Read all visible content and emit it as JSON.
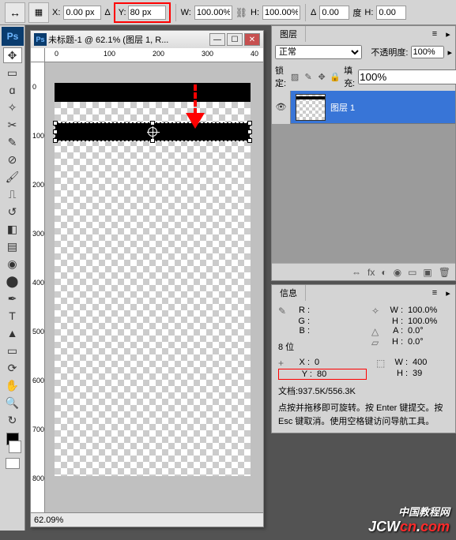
{
  "options": {
    "x_label": "X:",
    "x_value": "0.00 px",
    "delta_label": "Δ",
    "y_label": "Y:",
    "y_value": "80 px",
    "w_label": "W:",
    "w_value": "100.00%",
    "link_icon": "⛓",
    "h_label": "H:",
    "h_value": "100.00%",
    "angle_label": "Δ",
    "angle_value": "0.00",
    "angle_unit": "度",
    "skew_h_label": "H:",
    "skew_h_value": "0.00"
  },
  "doc": {
    "title": "未标题-1 @ 62.1% (图层 1, R...",
    "zoom": "62.09%",
    "ruler_marks_h": [
      "0",
      "100",
      "200",
      "300",
      "40"
    ],
    "ruler_marks_v": [
      "0",
      "100",
      "200",
      "300",
      "400",
      "500",
      "600",
      "700",
      "800"
    ]
  },
  "layers": {
    "tab": "图层",
    "blend_mode": "正常",
    "opacity_label": "不透明度:",
    "opacity_value": "100%",
    "lock_label": "锁定:",
    "fill_label": "填充:",
    "fill_value": "100%",
    "items": [
      {
        "name": "图层 1"
      }
    ],
    "footer_icons": [
      "⇔",
      "fx",
      "◐",
      "◉",
      "▭",
      "▣",
      "🗑"
    ]
  },
  "info": {
    "tab": "信息",
    "rgb": {
      "r_k": "R :",
      "g_k": "G :",
      "b_k": "B :"
    },
    "bitdepth": "8 位",
    "wh": {
      "w_k": "W :",
      "w_v": "100.0%",
      "h_k": "H :",
      "h_v": "100.0%",
      "a_k": "A :",
      "a_v": "0.0°",
      "sh_k": "H :",
      "sh_v": "0.0°"
    },
    "xy": {
      "x_k": "X :",
      "x_v": "0",
      "y_k": "Y :",
      "y_v": "80"
    },
    "wh2": {
      "w_k": "W :",
      "w_v": "400",
      "h_k": "H :",
      "h_v": "39"
    },
    "docsize": "文档:937.5K/556.3K",
    "hint": "点按并拖移即可旋转。按 Enter 键提交。按 Esc 键取消。使用空格键访问导航工具。"
  },
  "watermark": {
    "cn": "中国教程网",
    "domain_pre": "JCW",
    "domain_mid": "cn",
    "domain_suf": "com"
  }
}
